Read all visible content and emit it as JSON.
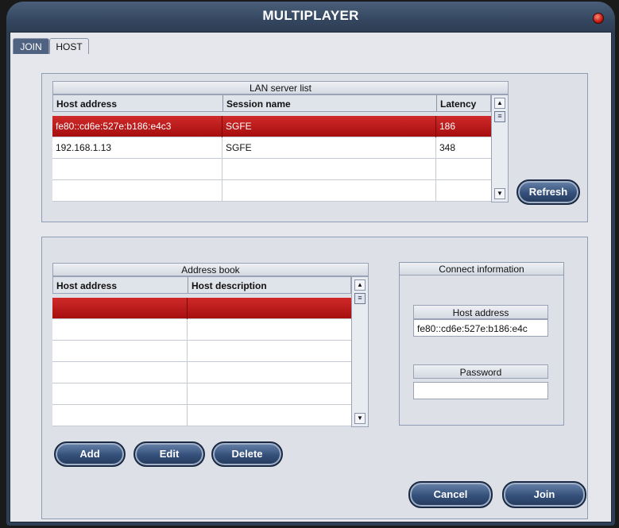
{
  "window": {
    "title": "MULTIPLAYER"
  },
  "tabs": [
    {
      "label": "JOIN",
      "active": true
    },
    {
      "label": "HOST",
      "active": false
    }
  ],
  "lan": {
    "caption": "LAN server list",
    "columns": [
      "Host address",
      "Session name",
      "Latency"
    ],
    "rows": [
      {
        "host": "fe80::cd6e:527e:b186:e4c3",
        "session": "SGFE",
        "latency": "186",
        "selected": true
      },
      {
        "host": "192.168.1.13",
        "session": "SGFE",
        "latency": "348",
        "selected": false
      },
      {
        "host": "",
        "session": "",
        "latency": "",
        "selected": false
      },
      {
        "host": "",
        "session": "",
        "latency": "",
        "selected": false
      }
    ],
    "refresh_label": "Refresh"
  },
  "address_book": {
    "caption": "Address book",
    "columns": [
      "Host address",
      "Host description"
    ],
    "row_count": 6,
    "selected_row": 0,
    "add_label": "Add",
    "edit_label": "Edit",
    "delete_label": "Delete"
  },
  "connect": {
    "caption": "Connect information",
    "host_label": "Host address",
    "host_value": "fe80::cd6e:527e:b186:e4c",
    "password_label": "Password",
    "password_value": ""
  },
  "footer": {
    "cancel_label": "Cancel",
    "join_label": "Join"
  },
  "colors": {
    "selection": "#b81818",
    "accent": "#34507a",
    "frame": "#2e3e54"
  }
}
